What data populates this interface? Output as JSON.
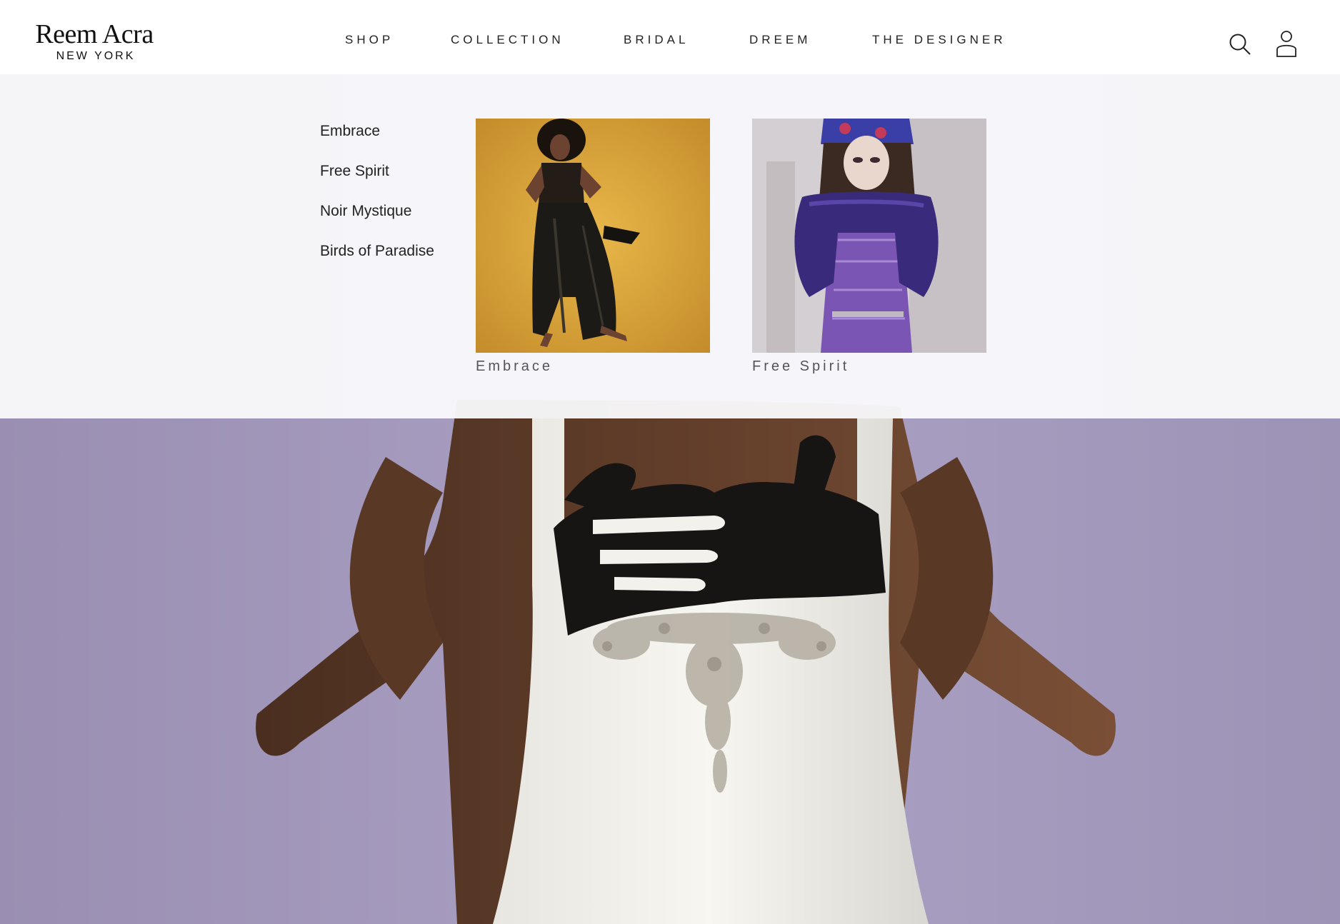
{
  "brand": {
    "name": "Reem Acra",
    "city": "NEW YORK"
  },
  "nav": {
    "items": [
      "SHOP",
      "COLLECTION",
      "BRIDAL",
      "DREEM",
      "THE DESIGNER"
    ]
  },
  "icons": {
    "search": "search-icon",
    "account": "user-icon"
  },
  "collection_menu": {
    "links": [
      "Embrace",
      "Free Spirit",
      "Noir Mystique",
      "Birds of Paradise"
    ],
    "featured": [
      {
        "caption": "Embrace"
      },
      {
        "caption": "Free Spirit"
      }
    ]
  },
  "colors": {
    "hero_background": "#a79dc0",
    "card_embrace_background": "#d9a53a",
    "card_freespirit_background": "#cfc9cf",
    "text": "#222222"
  }
}
